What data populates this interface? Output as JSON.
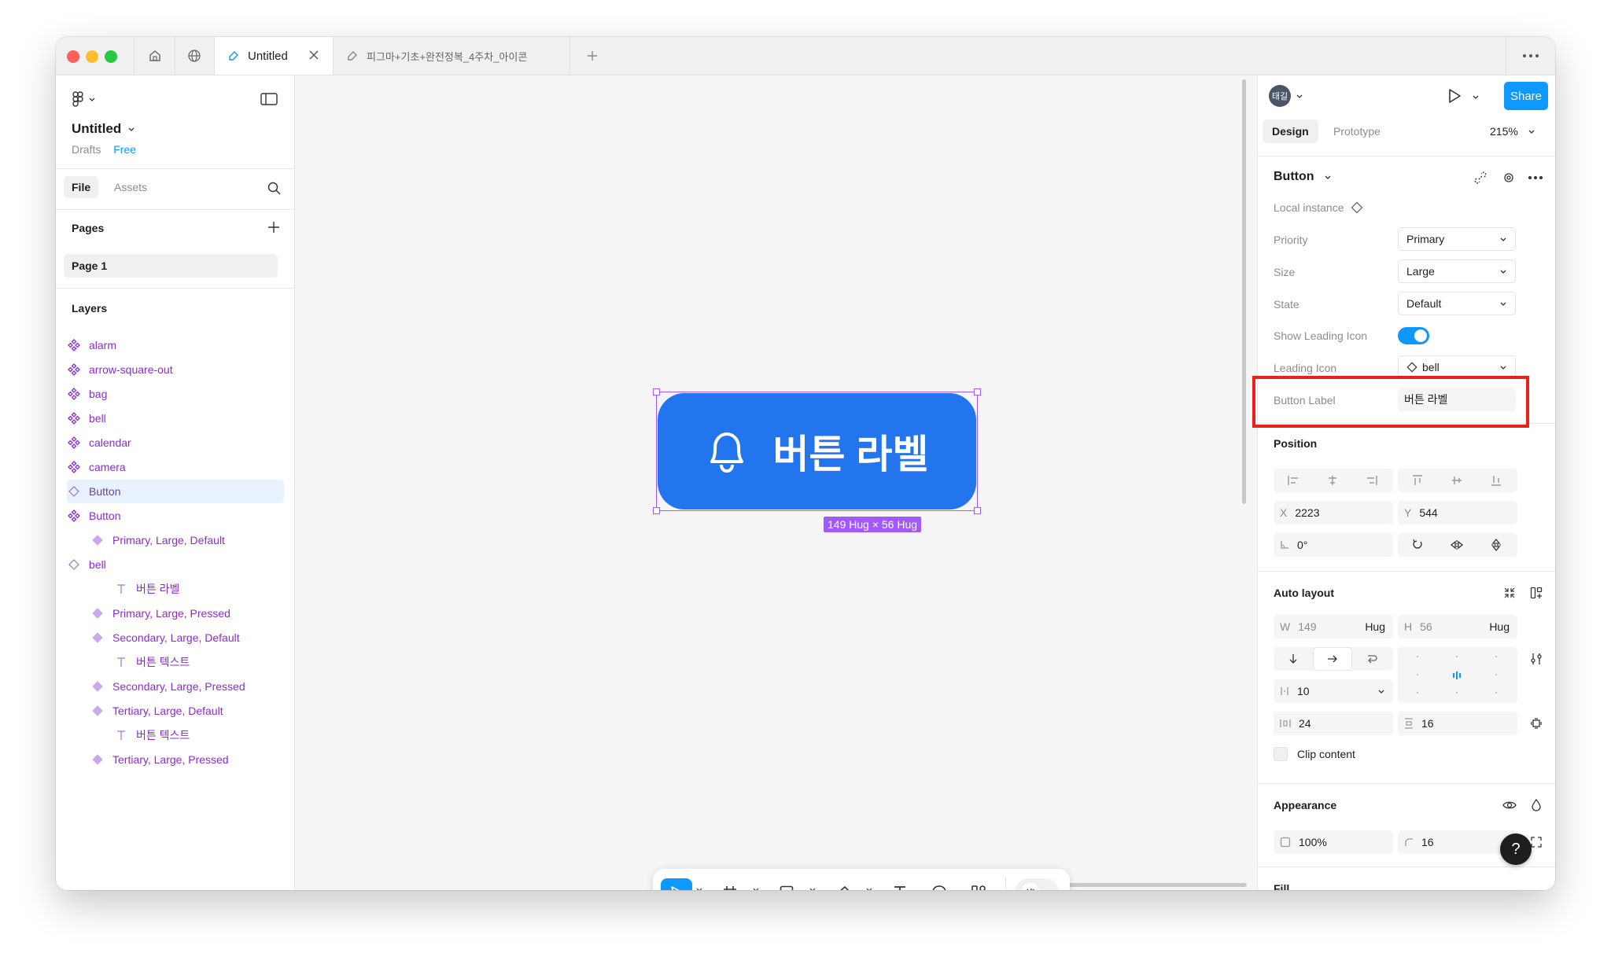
{
  "window": {
    "tabs": [
      {
        "label": "Untitled",
        "active": true
      },
      {
        "label": "피그마+기초+완전정복_4주차_아이콘",
        "active": false
      }
    ]
  },
  "left_panel": {
    "file_title": "Untitled",
    "location": "Drafts",
    "plan_badge": "Free",
    "tabs": [
      "File",
      "Assets"
    ],
    "pages_header": "Pages",
    "pages": [
      "Page 1"
    ],
    "layers_header": "Layers",
    "layers": [
      {
        "label": "alarm",
        "icon": "component-icon"
      },
      {
        "label": "arrow-square-out",
        "icon": "component-icon"
      },
      {
        "label": "bag",
        "icon": "component-icon"
      },
      {
        "label": "bell",
        "icon": "component-icon"
      },
      {
        "label": "calendar",
        "icon": "component-icon"
      },
      {
        "label": "camera",
        "icon": "component-icon"
      },
      {
        "label": "Button",
        "icon": "instance-icon",
        "selected": true
      },
      {
        "label": "Button",
        "icon": "component-set-icon"
      },
      {
        "label": "Primary, Large, Default",
        "icon": "variant-icon"
      },
      {
        "label": "bell",
        "icon": "instance-icon"
      },
      {
        "label": "버튼 라벨",
        "icon": "text-icon"
      },
      {
        "label": "Primary, Large, Pressed",
        "icon": "variant-icon"
      },
      {
        "label": "Secondary, Large, Default",
        "icon": "variant-icon"
      },
      {
        "label": "버튼 텍스트",
        "icon": "text-icon"
      },
      {
        "label": "Secondary, Large, Pressed",
        "icon": "variant-icon"
      },
      {
        "label": "Tertiary, Large, Default",
        "icon": "variant-icon"
      },
      {
        "label": "버튼 텍스트",
        "icon": "text-icon"
      },
      {
        "label": "Tertiary, Large, Pressed",
        "icon": "variant-icon"
      }
    ]
  },
  "canvas": {
    "button_label": "버튼 라벨",
    "size_badge": "149 Hug × 56 Hug",
    "accent": "#2375ee",
    "selection_color": "#a259ff"
  },
  "right_panel": {
    "avatar": "태길",
    "share_label": "Share",
    "tabs": [
      "Design",
      "Prototype"
    ],
    "zoom": "215%",
    "component_name": "Button",
    "local_instance": "Local instance",
    "props": {
      "priority_label": "Priority",
      "priority_value": "Primary",
      "size_label": "Size",
      "size_value": "Large",
      "state_label": "State",
      "state_value": "Default",
      "show_leading_label": "Show Leading Icon",
      "show_leading_on": true,
      "leading_icon_label": "Leading Icon",
      "leading_icon_value": "bell",
      "button_label_label": "Button Label",
      "button_label_value": "버튼 라벨"
    },
    "position": {
      "header": "Position",
      "x_label": "X",
      "x": "2223",
      "y_label": "Y",
      "y": "544",
      "rotation": "0°"
    },
    "auto_layout": {
      "header": "Auto layout",
      "w_label": "W",
      "w": "149",
      "w_mode": "Hug",
      "h_label": "H",
      "h": "56",
      "h_mode": "Hug",
      "gap": "10",
      "padding_h": "24",
      "padding_v": "16",
      "clip_content": "Clip content"
    },
    "appearance": {
      "header": "Appearance",
      "opacity": "100%",
      "radius": "16"
    },
    "fill_header": "Fill"
  },
  "highlight_color": "#e5231b"
}
